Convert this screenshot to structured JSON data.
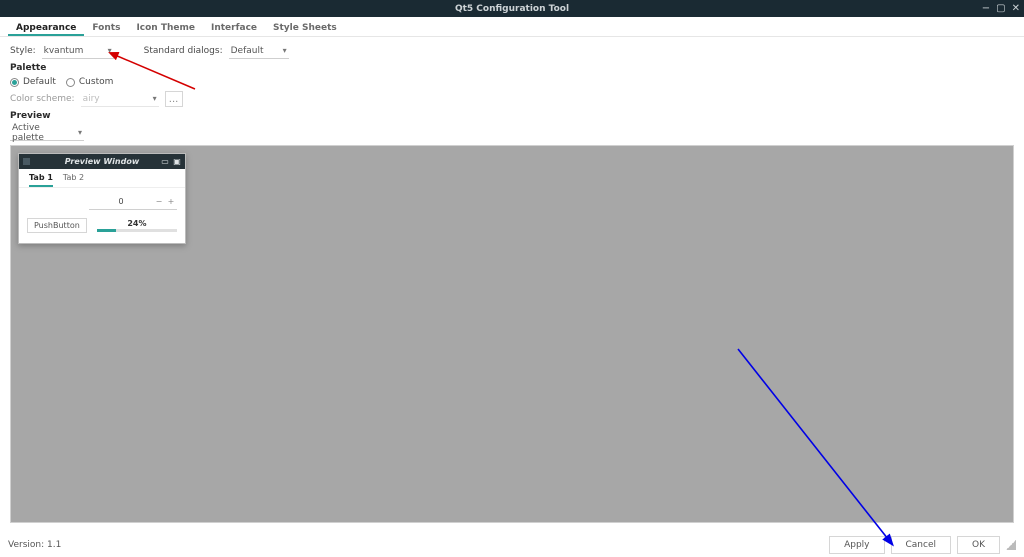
{
  "window": {
    "title": "Qt5 Configuration Tool"
  },
  "tabs": {
    "items": [
      "Appearance",
      "Fonts",
      "Icon Theme",
      "Interface",
      "Style Sheets"
    ],
    "active_index": 0
  },
  "appearance": {
    "style_label": "Style:",
    "style_value": "kvantum",
    "dialogs_label": "Standard dialogs:",
    "dialogs_value": "Default",
    "palette_head": "Palette",
    "radio_default": "Default",
    "radio_custom": "Custom",
    "radio_selected": "default",
    "color_scheme_label": "Color scheme:",
    "color_scheme_value": "airy",
    "browse_btn": "...",
    "preview_head": "Preview",
    "preview_palette_value": "Active palette"
  },
  "preview_window": {
    "title": "Preview Window",
    "tabs": [
      "Tab 1",
      "Tab 2"
    ],
    "active_tab": 0,
    "spinner_value": "0",
    "push_button": "PushButton",
    "progress_label": "24%",
    "progress_value": 24
  },
  "footer": {
    "version": "Version: 1.1",
    "apply": "Apply",
    "cancel": "Cancel",
    "ok": "OK"
  }
}
